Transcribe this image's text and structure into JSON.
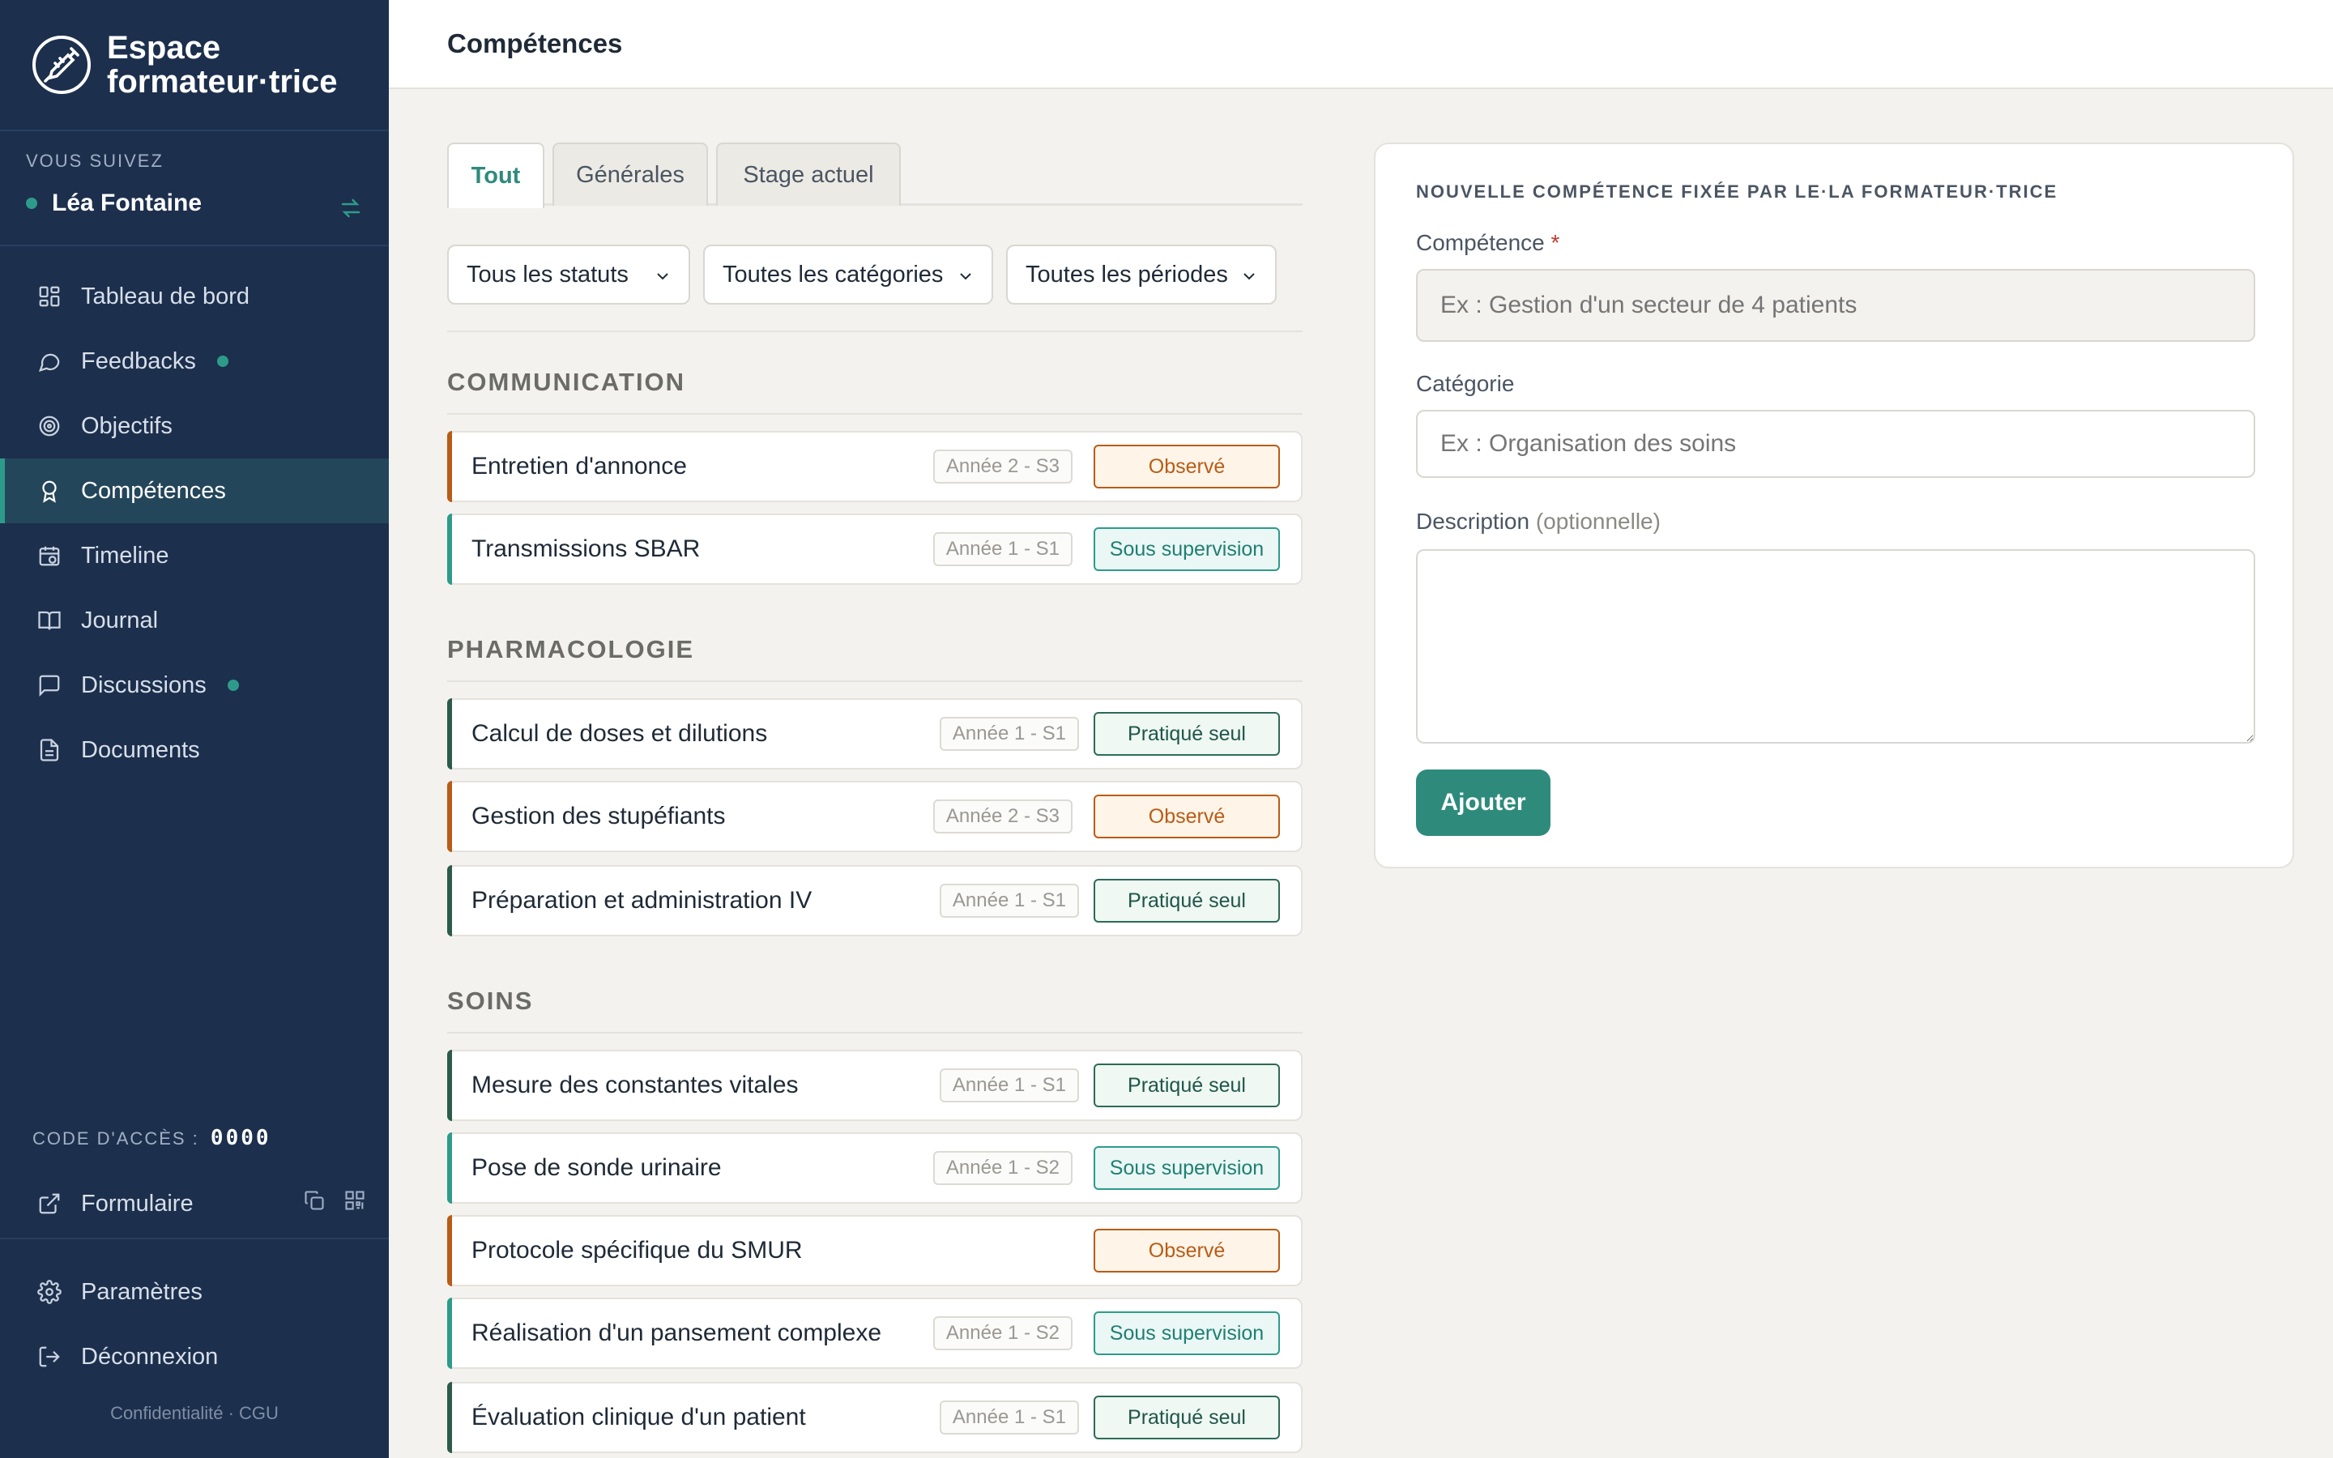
{
  "app": {
    "brand_line1": "Espace",
    "brand_line2": "formateur·trice"
  },
  "follow": {
    "label": "VOUS SUIVEZ",
    "name": "Léa Fontaine"
  },
  "nav": [
    {
      "label": "Tableau de bord",
      "icon": "dashboard-icon"
    },
    {
      "label": "Feedbacks",
      "icon": "chat-bubble-icon",
      "dot": true
    },
    {
      "label": "Objectifs",
      "icon": "target-icon"
    },
    {
      "label": "Compétences",
      "icon": "award-icon",
      "active": true
    },
    {
      "label": "Timeline",
      "icon": "calendar-clock-icon"
    },
    {
      "label": "Journal",
      "icon": "book-icon"
    },
    {
      "label": "Discussions",
      "icon": "message-square-icon",
      "dot": true
    },
    {
      "label": "Documents",
      "icon": "file-icon"
    }
  ],
  "access": {
    "label": "CODE D'ACCÈS :",
    "code": "0000"
  },
  "form_link": {
    "label": "Formulaire"
  },
  "bottom_nav": [
    {
      "label": "Paramètres",
      "icon": "gear-icon"
    },
    {
      "label": "Déconnexion",
      "icon": "logout-icon"
    }
  ],
  "legal": {
    "text": "Confidentialité · CGU"
  },
  "header": {
    "title": "Compétences"
  },
  "tabs": [
    {
      "label": "Tout",
      "active": true
    },
    {
      "label": "Générales"
    },
    {
      "label": "Stage actuel"
    }
  ],
  "filters": {
    "status": "Tous les statuts",
    "category": "Toutes les catégories",
    "period": "Toutes les périodes"
  },
  "categories": [
    {
      "title": "COMMUNICATION",
      "items": [
        {
          "name": "Entretien d'annonce",
          "period": "Année 2 - S3",
          "status": "Observé",
          "kind": "obs"
        },
        {
          "name": "Transmissions SBAR",
          "period": "Année 1 - S1",
          "status": "Sous supervision",
          "kind": "sup"
        }
      ]
    },
    {
      "title": "PHARMACOLOGIE",
      "items": [
        {
          "name": "Calcul de doses et dilutions",
          "period": "Année 1 - S1",
          "status": "Pratiqué seul",
          "kind": "pra"
        },
        {
          "name": "Gestion des stupéfiants",
          "period": "Année 2 - S3",
          "status": "Observé",
          "kind": "obs"
        },
        {
          "name": "Préparation et administration IV",
          "period": "Année 1 - S1",
          "status": "Pratiqué seul",
          "kind": "pra"
        }
      ]
    },
    {
      "title": "SOINS",
      "items": [
        {
          "name": "Mesure des constantes vitales",
          "period": "Année 1 - S1",
          "status": "Pratiqué seul",
          "kind": "pra"
        },
        {
          "name": "Pose de sonde urinaire",
          "period": "Année 1 - S2",
          "status": "Sous supervision",
          "kind": "sup"
        },
        {
          "name": "Protocole spécifique du SMUR",
          "period": "",
          "status": "Observé",
          "kind": "obs"
        },
        {
          "name": "Réalisation d'un pansement complexe",
          "period": "Année 1 - S2",
          "status": "Sous supervision",
          "kind": "sup"
        },
        {
          "name": "Évaluation clinique d'un patient",
          "period": "Année 1 - S1",
          "status": "Pratiqué seul",
          "kind": "pra"
        }
      ]
    }
  ],
  "new_skill": {
    "title": "NOUVELLE COMPÉTENCE FIXÉE PAR LE·LA FORMATEUR·TRICE",
    "competence_label": "Compétence",
    "competence_required": "*",
    "competence_placeholder": "Ex : Gestion d'un secteur de 4 patients",
    "category_label": "Catégorie",
    "category_placeholder": "Ex : Organisation des soins",
    "description_label": "Description",
    "description_optional": "(optionnelle)",
    "submit": "Ajouter"
  },
  "colors": {
    "sidebar": "#1c2f4d",
    "accent": "#2e8b7c",
    "observed": "#b85c16",
    "supervision": "#2e9b8a",
    "practiced": "#2d5a4a"
  }
}
